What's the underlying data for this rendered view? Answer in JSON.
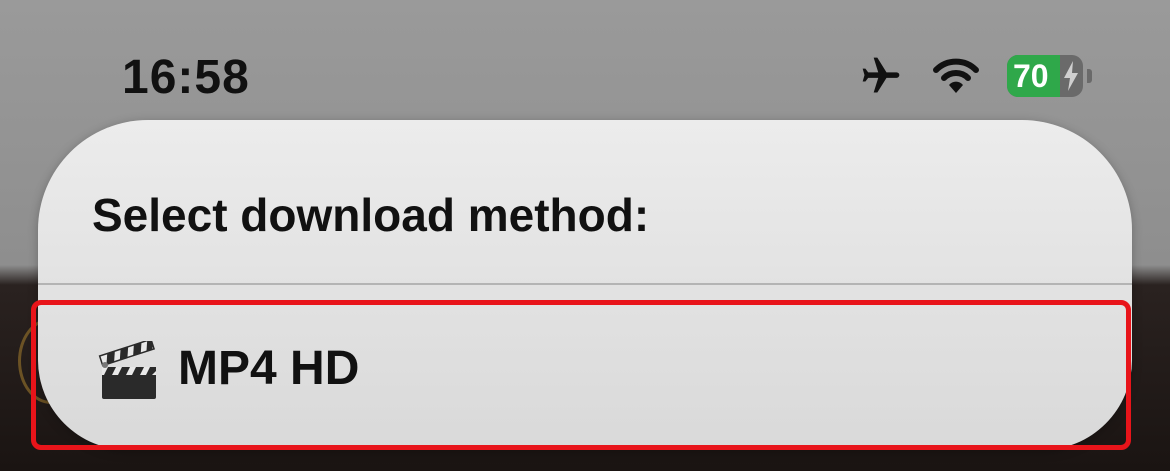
{
  "status_bar": {
    "time": "16:58",
    "battery_percent": "70",
    "battery_level": 0.7,
    "icons": [
      "airplane-icon",
      "wifi-icon",
      "battery-icon",
      "charging-bolt-icon"
    ]
  },
  "dialog": {
    "title": "Select download method:",
    "options": [
      {
        "icon": "clapper-board-icon",
        "emoji": "🎬",
        "label": "MP4 HD"
      }
    ]
  },
  "colors": {
    "highlight": "#e8141a",
    "battery_green": "#2fa84a",
    "sheet": "#e4e4e4"
  }
}
